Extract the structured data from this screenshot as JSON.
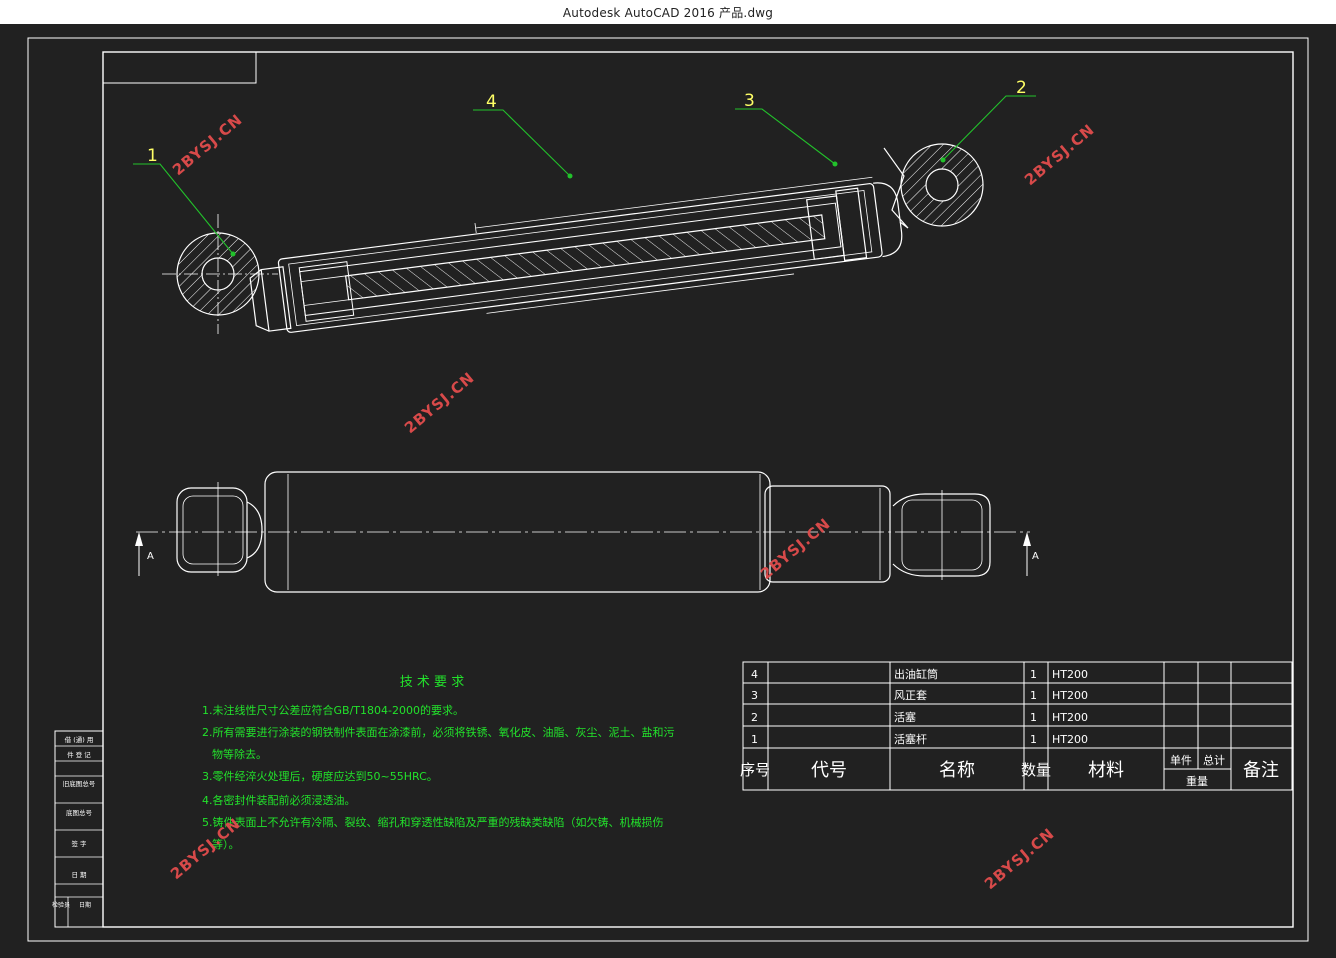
{
  "window": {
    "title": "Autodesk AutoCAD 2016    产品.dwg"
  },
  "callouts": [
    "1",
    "2",
    "3",
    "4"
  ],
  "section_marks": {
    "left": "A",
    "right": "A"
  },
  "watermark": "2BYSJ.CN",
  "tech_requirements": {
    "title": "技 术 要 求",
    "items": [
      "1.未注线性尺寸公差应符合GB/T1804-2000的要求。",
      "2.所有需要进行涂装的钢铁制件表面在涂漆前，必须将铁锈、氧化皮、油脂、灰尘、泥土、盐和污",
      "物等除去。",
      "3.零件经淬火处理后，硬度应达到50~55HRC。",
      "4.各密封件装配前必须浸透油。",
      "5.铸件表面上不允许有冷隔、裂纹、缩孔和穿透性缺陷及严重的残缺类缺陷（如欠铸、机械损伤",
      "等）。"
    ]
  },
  "bom": {
    "rows": [
      {
        "no": "4",
        "code": "",
        "name": "出油缸筒",
        "qty": "1",
        "material": "HT200",
        "unit": "",
        "total": "",
        "note": ""
      },
      {
        "no": "3",
        "code": "",
        "name": "风正套",
        "qty": "1",
        "material": "HT200",
        "unit": "",
        "total": "",
        "note": ""
      },
      {
        "no": "2",
        "code": "",
        "name": "活塞",
        "qty": "1",
        "material": "HT200",
        "unit": "",
        "total": "",
        "note": ""
      },
      {
        "no": "1",
        "code": "",
        "name": "活塞杆",
        "qty": "1",
        "material": "HT200",
        "unit": "",
        "total": "",
        "note": ""
      }
    ],
    "header": {
      "no": "序号",
      "code": "代号",
      "name": "名称",
      "qty": "数量",
      "material": "材料",
      "unit": "单件",
      "total": "总计",
      "weight": "重量",
      "note": "备注"
    }
  },
  "side_table": [
    "借 (通) 用",
    "件 登 记",
    "旧底图总号",
    "底图总号",
    "签  字",
    "日  期",
    "检验员",
    "日期"
  ],
  "colors": {
    "background": "#212121",
    "lines": "#ffffff",
    "leader": "#22c22b",
    "text_green": "#22e22b",
    "callout": "#ffff66",
    "watermark": "#d84a4a"
  }
}
